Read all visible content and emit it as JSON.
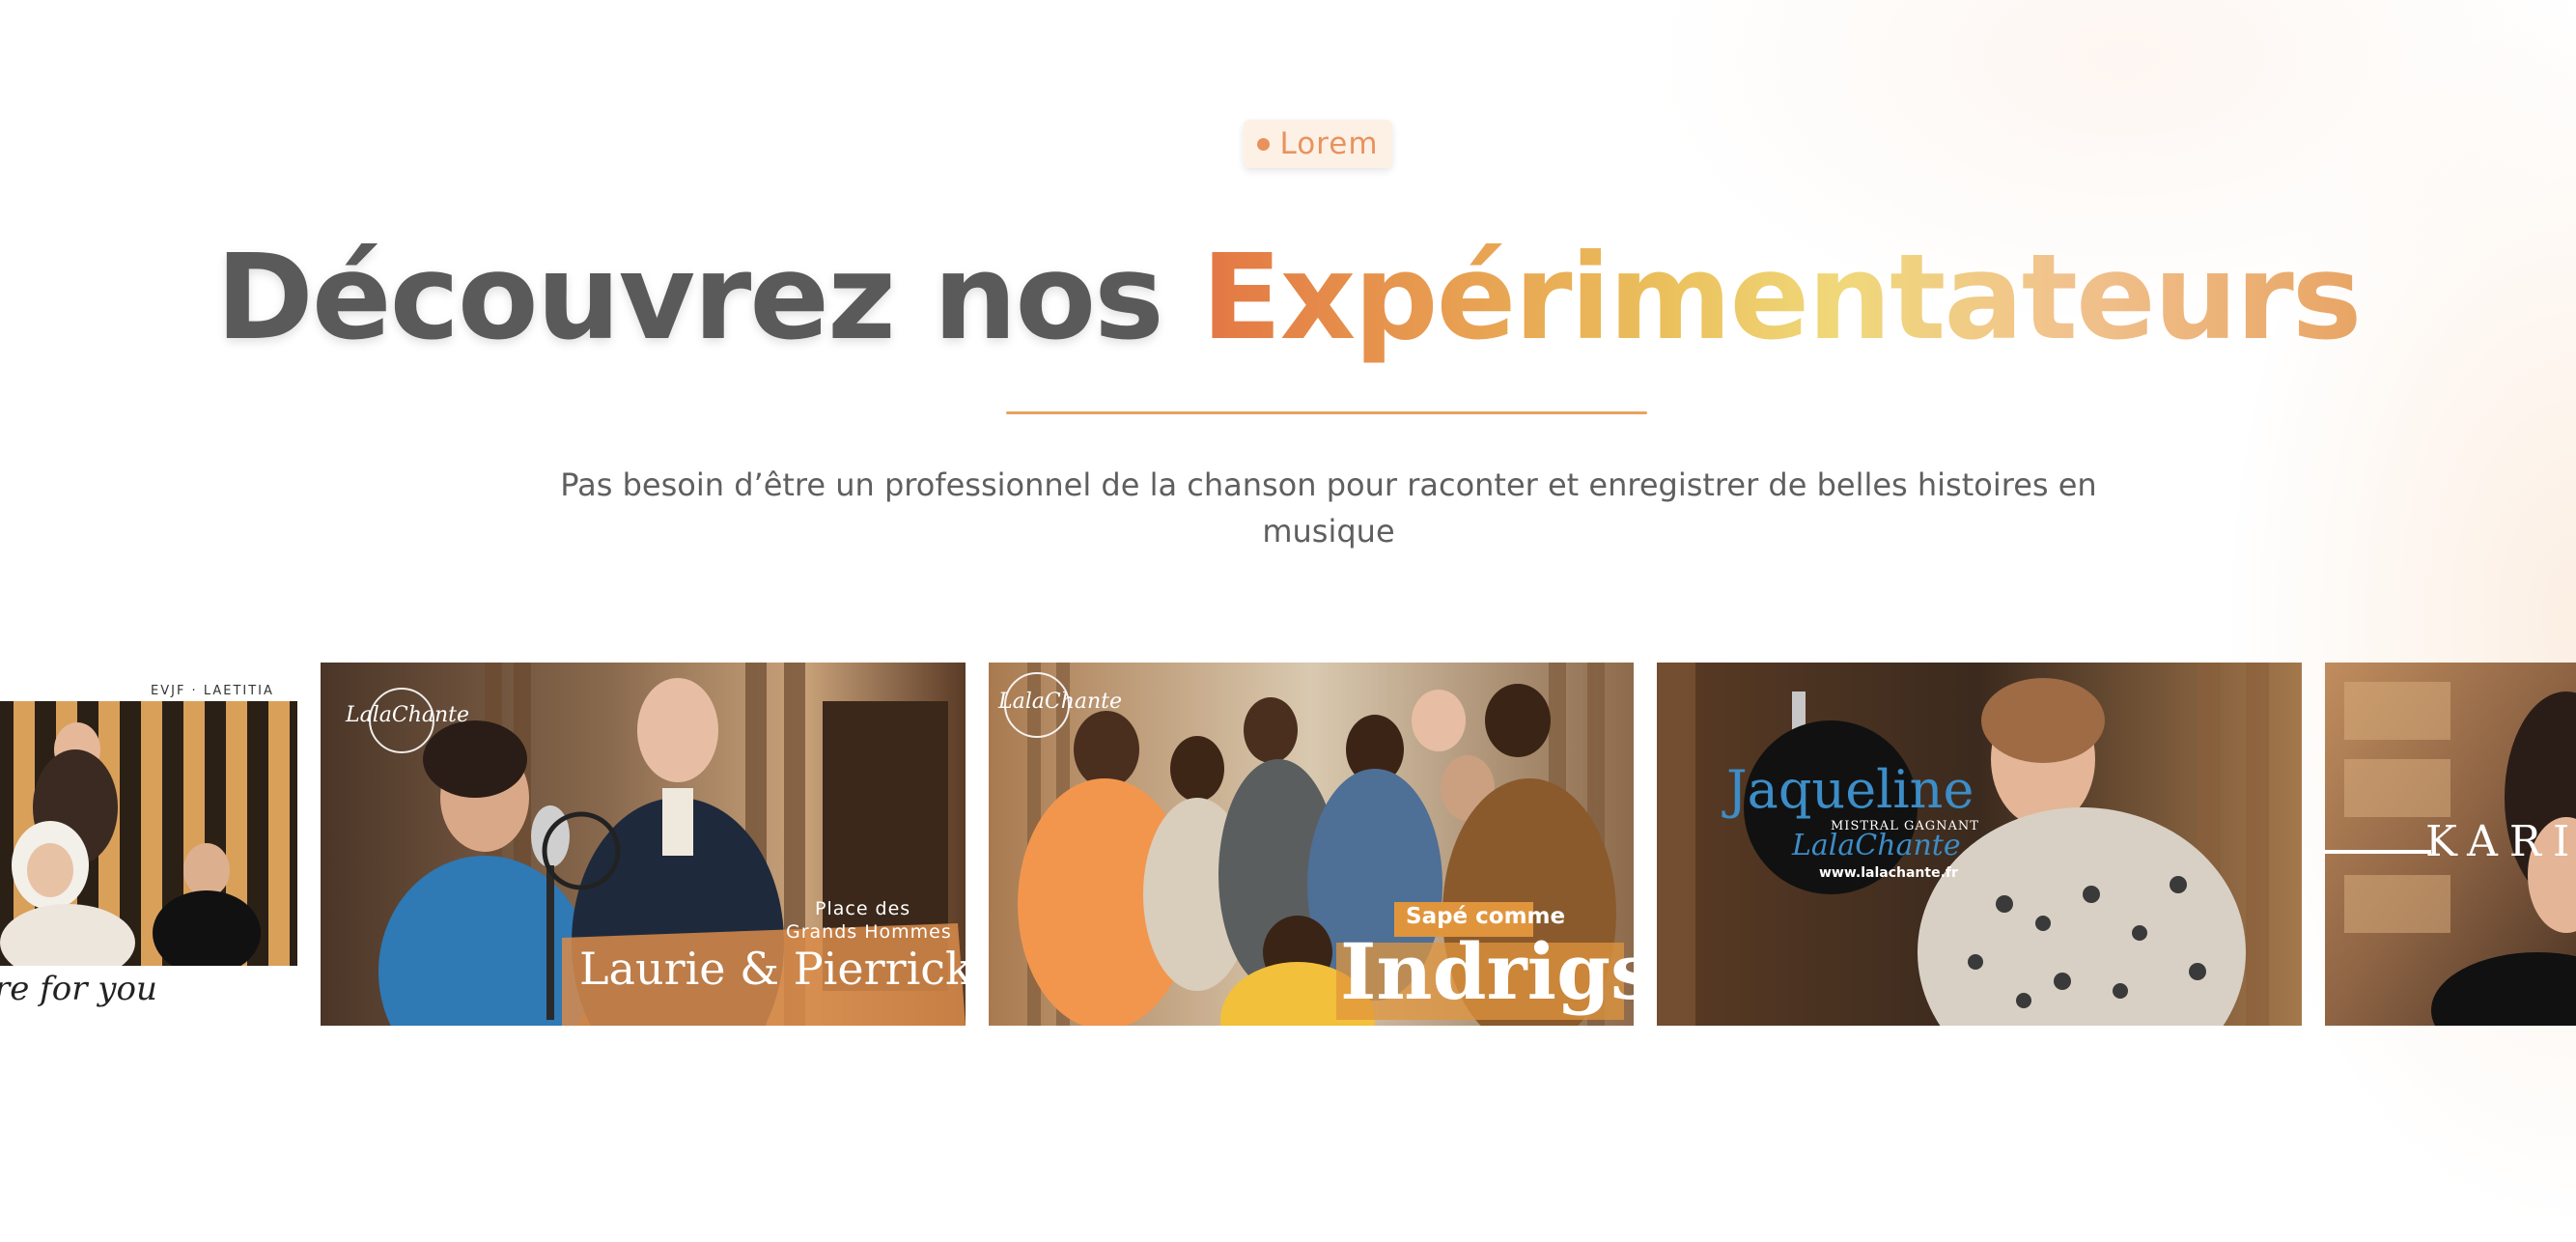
{
  "badge": {
    "label": "Lorem"
  },
  "headline": {
    "part_dark": "Découvrez nos ",
    "part_accent": "Expérimentateurs"
  },
  "subtitle": {
    "line1": "Pas besoin d’être un professionnel de la chanson pour raconter et enregistrer de belles histoires en",
    "line2": "musique"
  },
  "gallery": {
    "cards": [
      {
        "caption_top": "EVJF · LAETITIA",
        "caption_bottom": "re for you"
      },
      {
        "logo": "LalaChante",
        "place": "Place des",
        "place2": "Grands Hommes",
        "title": "Laurie & Pierrick"
      },
      {
        "logo": "LalaChante",
        "tag": "Sapé comme",
        "title": "Indrigs"
      },
      {
        "name": "Jaqueline",
        "subtitle": "MISTRAL GAGNANT",
        "logo": "LalaChante",
        "url": "www.lalachante.fr"
      },
      {
        "title": "KARI"
      }
    ]
  },
  "colors": {
    "accent_orange": "#e37744",
    "accent_yellow": "#f0d87a",
    "text_dark": "#5a5a5a",
    "badge_bg": "#fdf1e6"
  }
}
